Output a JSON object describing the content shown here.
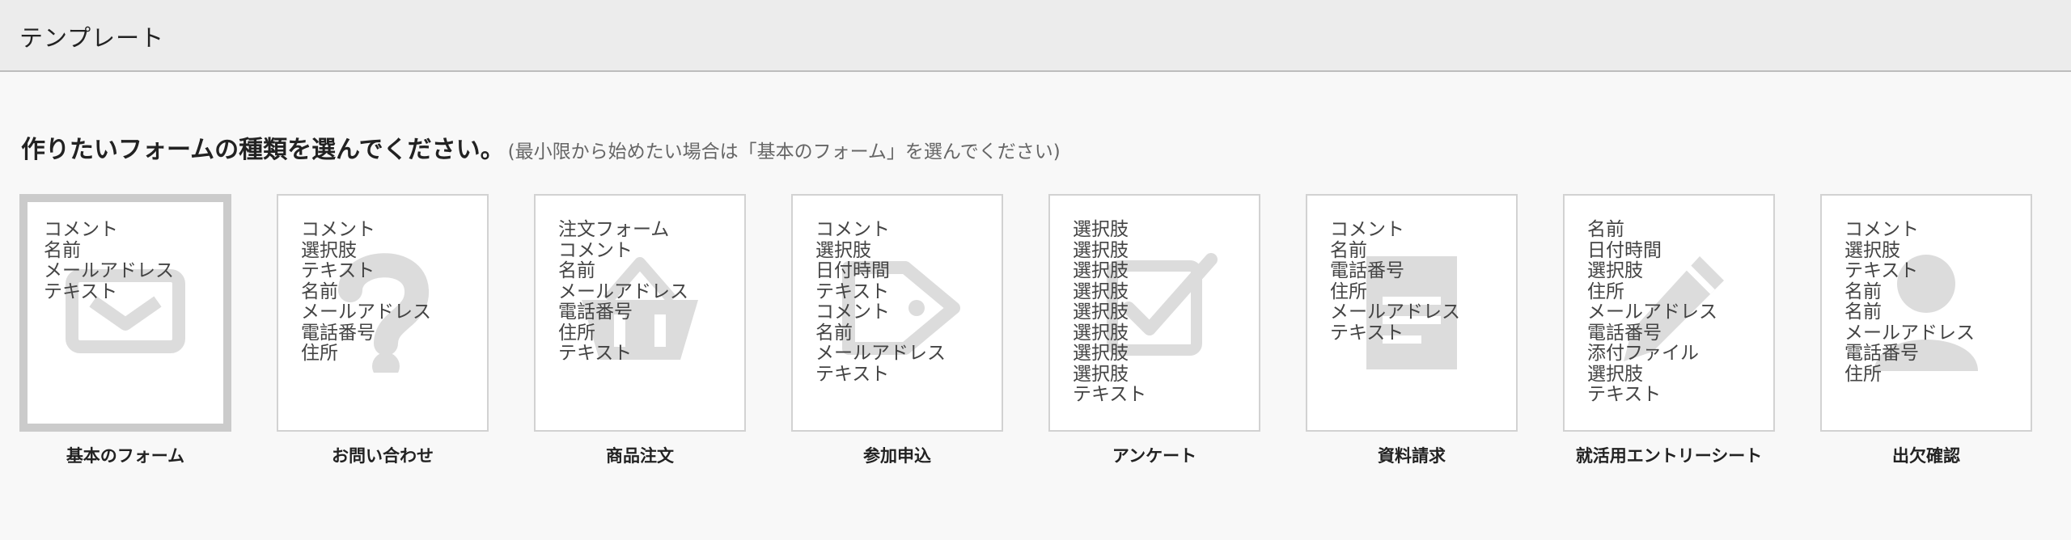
{
  "header": {
    "title": "テンプレート"
  },
  "prompt": {
    "main": "作りたいフォームの種類を選んでください。",
    "sub": "(最小限から始めたい場合は「基本のフォーム」を選んでください)"
  },
  "colors": {
    "header_bg": "#ececec",
    "page_bg": "#f8f8f8",
    "card_border": "#d2d2d2",
    "selected_border": "#cbcbcb",
    "icon_gray": "#dcdcdc"
  },
  "templates": [
    {
      "label": "基本のフォーム",
      "icon": "envelope-icon",
      "selected": true,
      "fields": [
        "コメント",
        "名前",
        "メールアドレス",
        "テキスト"
      ]
    },
    {
      "label": "お問い合わせ",
      "icon": "question-icon",
      "selected": false,
      "fields": [
        "コメント",
        "選択肢",
        "テキスト",
        "名前",
        "メールアドレス",
        "電話番号",
        "住所"
      ]
    },
    {
      "label": "商品注文",
      "icon": "basket-icon",
      "selected": false,
      "fields": [
        "注文フォーム",
        "コメント",
        "名前",
        "メールアドレス",
        "電話番号",
        "住所",
        "テキスト"
      ]
    },
    {
      "label": "参加申込",
      "icon": "tag-icon",
      "selected": false,
      "fields": [
        "コメント",
        "選択肢",
        "日付時間",
        "テキスト",
        "コメント",
        "名前",
        "メールアドレス",
        "テキスト"
      ]
    },
    {
      "label": "アンケート",
      "icon": "checkbox-icon",
      "selected": false,
      "fields": [
        "選択肢",
        "選択肢",
        "選択肢",
        "選択肢",
        "選択肢",
        "選択肢",
        "選択肢",
        "選択肢",
        "テキスト"
      ]
    },
    {
      "label": "資料請求",
      "icon": "document-icon",
      "selected": false,
      "fields": [
        "コメント",
        "名前",
        "電話番号",
        "住所",
        "メールアドレス",
        "テキスト"
      ]
    },
    {
      "label": "就活用エントリーシート",
      "icon": "pencil-icon",
      "selected": false,
      "fields": [
        "名前",
        "日付時間",
        "選択肢",
        "住所",
        "メールアドレス",
        "電話番号",
        "添付ファイル",
        "選択肢",
        "テキスト"
      ]
    },
    {
      "label": "出欠確認",
      "icon": "person-icon",
      "selected": false,
      "fields": [
        "コメント",
        "選択肢",
        "テキスト",
        "名前",
        "名前",
        "メールアドレス",
        "電話番号",
        "住所"
      ]
    }
  ]
}
